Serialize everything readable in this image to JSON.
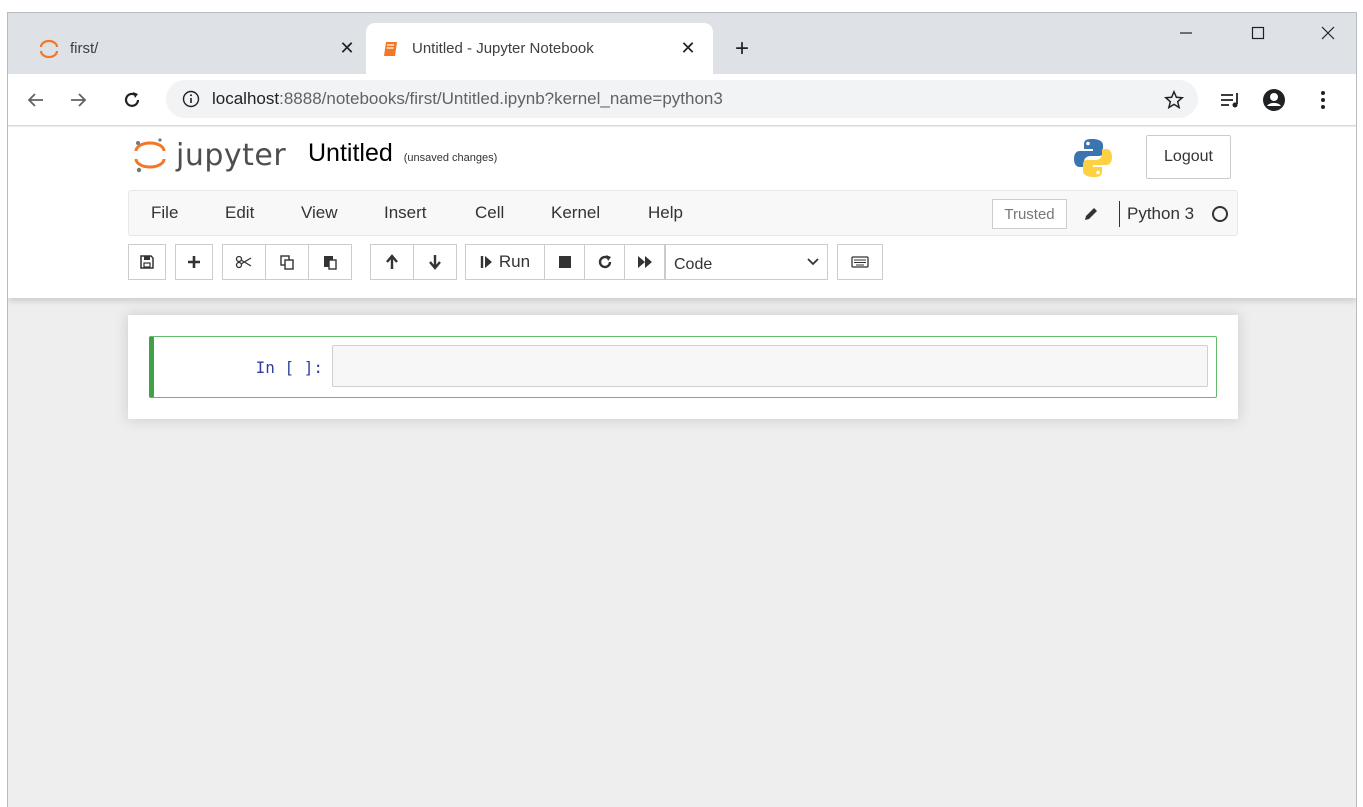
{
  "browser": {
    "tabs": [
      {
        "title": "first/",
        "icon": "jupyter-spinner-icon",
        "active": false
      },
      {
        "title": "Untitled - Jupyter Notebook",
        "icon": "notebook-icon",
        "active": true
      }
    ],
    "address": {
      "host": "localhost",
      "rest": ":8888/notebooks/first/Untitled.ipynb?kernel_name=python3"
    },
    "colors": {
      "tab_strip": "#dee1e6",
      "jupyter_orange": "#f37726"
    }
  },
  "header": {
    "logo_text": "jupyter",
    "notebook_name": "Untitled",
    "save_status": "(unsaved changes)",
    "logout_label": "Logout"
  },
  "menubar": {
    "items": [
      "File",
      "Edit",
      "View",
      "Insert",
      "Cell",
      "Kernel",
      "Help"
    ],
    "trusted_label": "Trusted",
    "kernel_name": "Python 3"
  },
  "toolbar": {
    "run_label": "Run",
    "cell_type": "Code"
  },
  "cells": [
    {
      "prompt": "In [ ]:",
      "source": ""
    }
  ]
}
